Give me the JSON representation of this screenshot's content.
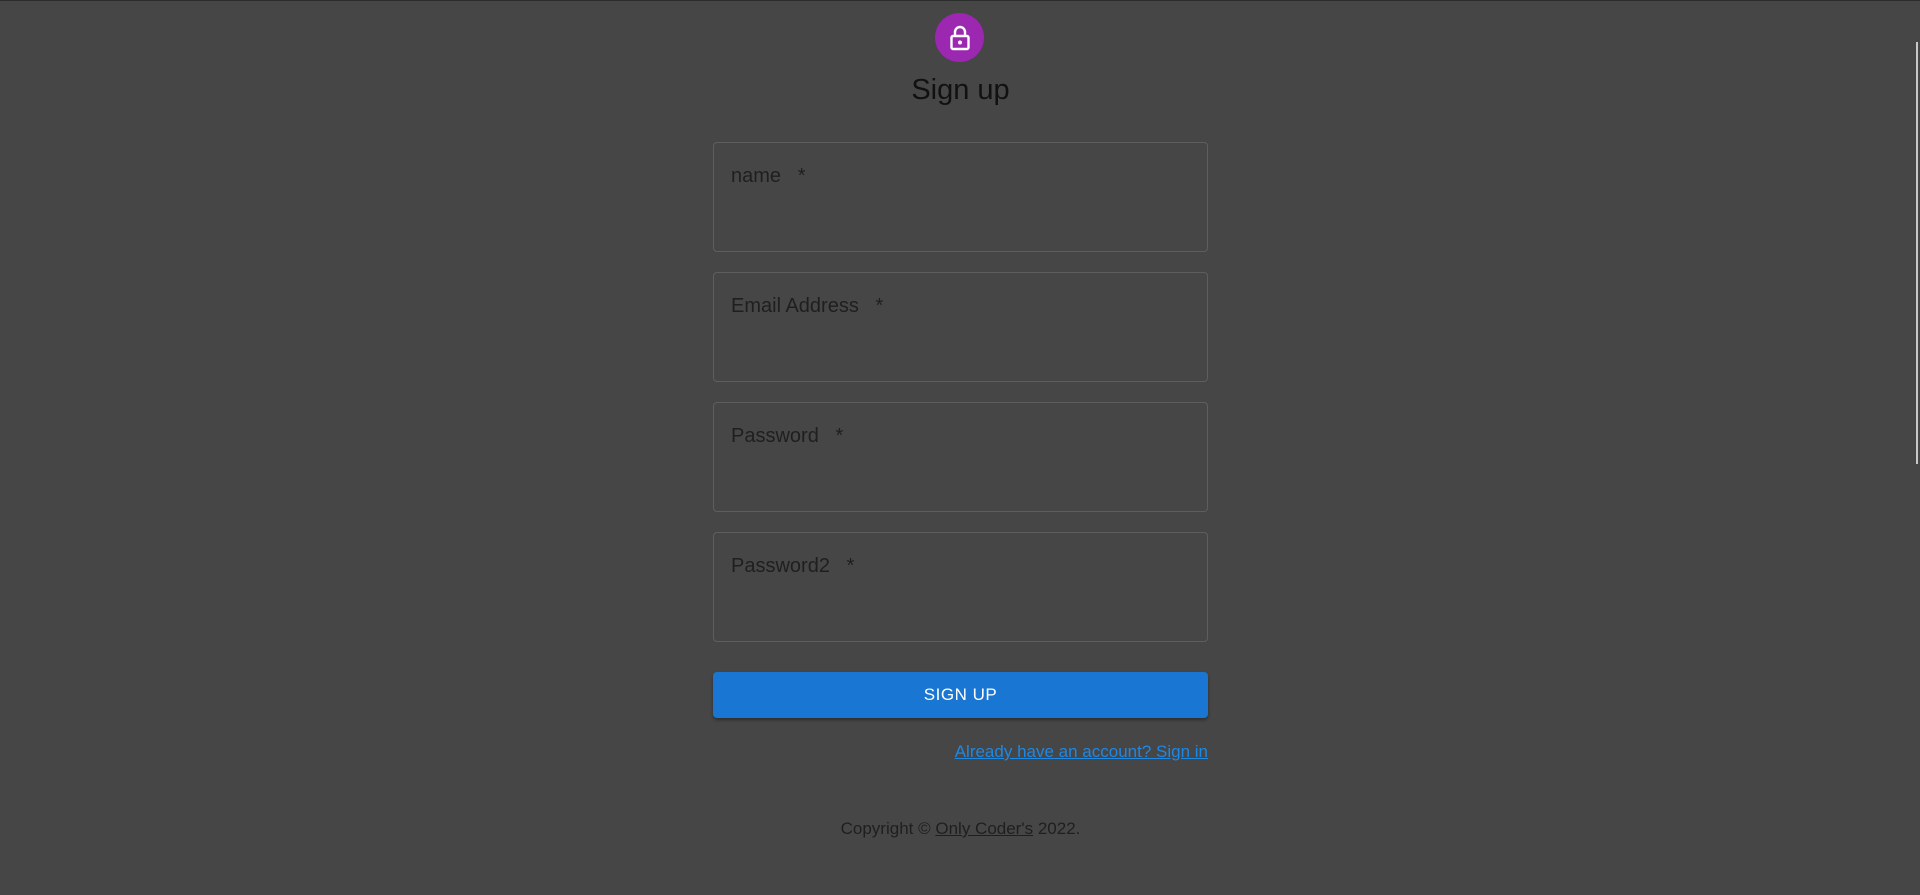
{
  "header": {
    "icon": "lock-icon",
    "title": "Sign up"
  },
  "form": {
    "fields": [
      {
        "label": "name",
        "required_mark": "*",
        "value": ""
      },
      {
        "label": "Email Address",
        "required_mark": "*",
        "value": ""
      },
      {
        "label": "Password",
        "required_mark": "*",
        "value": ""
      },
      {
        "label": "Password2",
        "required_mark": "*",
        "value": ""
      }
    ],
    "submit_label": "SIGN UP",
    "signin_link": "Already have an account? Sign in"
  },
  "footer": {
    "prefix": "Copyright ©",
    "brand": "Only Coder's",
    "suffix": "2022."
  },
  "colors": {
    "background": "#464646",
    "avatar": "#9c27b0",
    "primary": "#1976d2",
    "link": "#1e88e5"
  }
}
